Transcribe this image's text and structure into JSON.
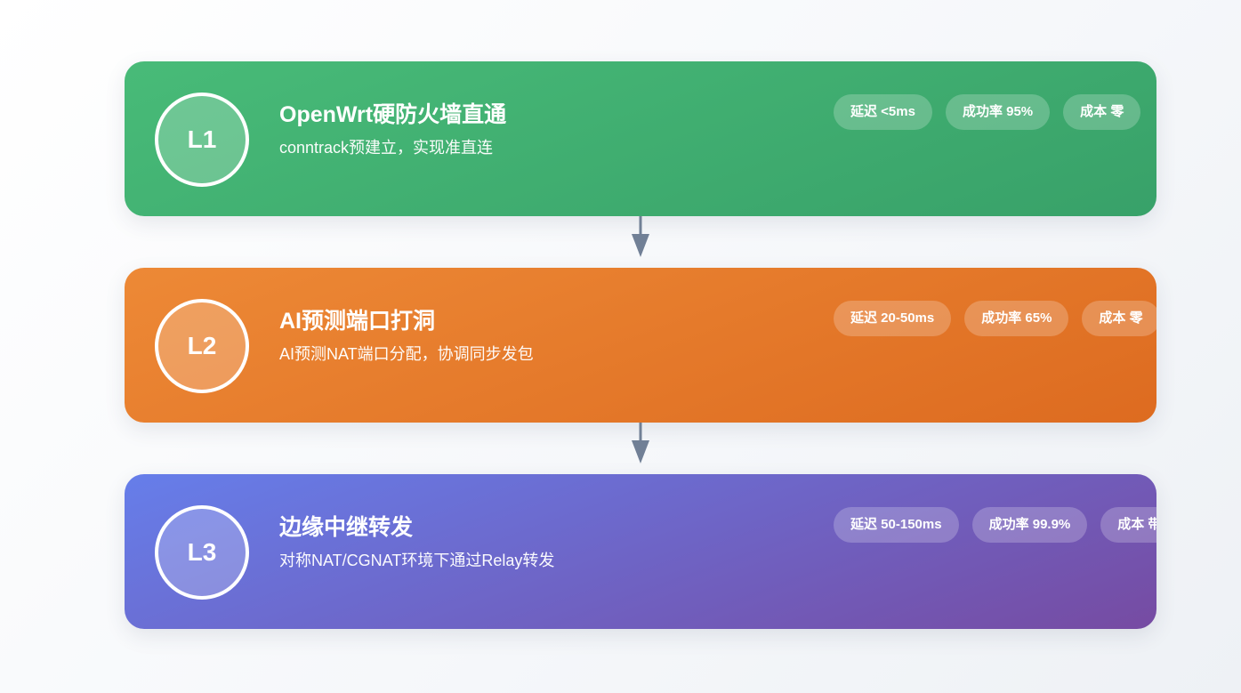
{
  "layers": [
    {
      "id": "L1",
      "title": "OpenWrt硬防火墙直通",
      "description": "conntrack预建立，实现准直连",
      "metrics": [
        {
          "label": "延迟 <5ms"
        },
        {
          "label": "成功率 95%"
        },
        {
          "label": "成本 零"
        }
      ],
      "color": "#48bb78"
    },
    {
      "id": "L2",
      "title": "AI预测端口打洞",
      "description": "AI预测NAT端口分配，协调同步发包",
      "metrics": [
        {
          "label": "延迟 20-50ms"
        },
        {
          "label": "成功率 65%"
        },
        {
          "label": "成本 零"
        }
      ],
      "color": "#ed8936"
    },
    {
      "id": "L3",
      "title": "边缘中继转发",
      "description": "对称NAT/CGNAT环境下通过Relay转发",
      "metrics": [
        {
          "label": "延迟 50-150ms"
        },
        {
          "label": "成功率 99.9%"
        },
        {
          "label": "成本 带宽费用"
        }
      ],
      "color": "#667eea"
    }
  ],
  "arrow_color": "#718096"
}
